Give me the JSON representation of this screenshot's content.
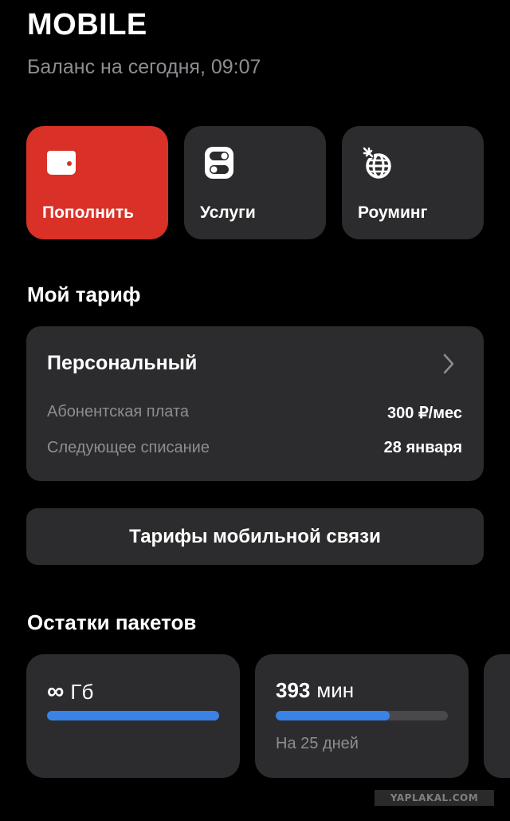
{
  "header": {
    "title": "MOBILE",
    "subtitle": "Баланс на сегодня, 09:07"
  },
  "actions": [
    {
      "label": "Пополнить",
      "icon": "wallet-icon",
      "color": "#d93127"
    },
    {
      "label": "Услуги",
      "icon": "toggles-icon",
      "color": "#2c2c2e"
    },
    {
      "label": "Роуминг",
      "icon": "globe-plane-icon",
      "color": "#2c2c2e"
    }
  ],
  "tariff": {
    "heading": "Мой тариф",
    "name": "Персональный",
    "rows": [
      {
        "label": "Абонентская плата",
        "value": "300 ₽/мес"
      },
      {
        "label": "Следующее списание",
        "value": "28 января"
      }
    ]
  },
  "tariffs_button": "Тарифы мобильной связи",
  "packages": {
    "heading": "Остатки пакетов",
    "items": [
      {
        "symbol": "∞",
        "value": "",
        "unit": "Гб",
        "progress": 1.0,
        "note": ""
      },
      {
        "symbol": "",
        "value": "393",
        "unit": "мин",
        "progress": 0.66,
        "note": "На 25 дней"
      }
    ],
    "bar_color": "#3b82e6"
  },
  "watermark": "YAPLAKAL.COM"
}
